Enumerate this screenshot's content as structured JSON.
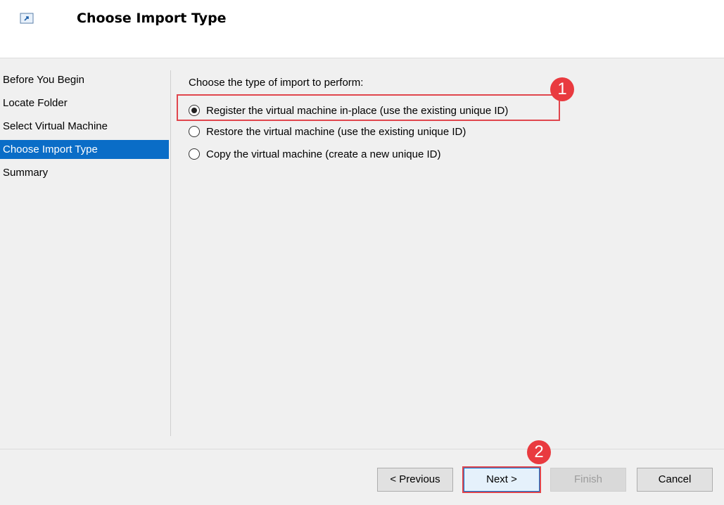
{
  "header": {
    "title": "Choose Import Type",
    "icon": "import-wizard-icon"
  },
  "nav": {
    "items": [
      {
        "label": "Before You Begin",
        "selected": false
      },
      {
        "label": "Locate Folder",
        "selected": false
      },
      {
        "label": "Select Virtual Machine",
        "selected": false
      },
      {
        "label": "Choose Import Type",
        "selected": true
      },
      {
        "label": "Summary",
        "selected": false
      }
    ]
  },
  "content": {
    "prompt": "Choose the type of import to perform:",
    "options": [
      {
        "label": "Register the virtual machine in-place (use the existing unique ID)",
        "checked": true
      },
      {
        "label": "Restore the virtual machine (use the existing unique ID)",
        "checked": false
      },
      {
        "label": "Copy the virtual machine (create a new unique ID)",
        "checked": false
      }
    ]
  },
  "annotations": {
    "step1": "1",
    "step2": "2",
    "highlight_color": "#e0464d",
    "badge_color": "#e93a3f"
  },
  "buttons": {
    "previous": "< Previous",
    "next": "Next >",
    "finish": "Finish",
    "cancel": "Cancel"
  },
  "colors": {
    "selection": "#0a6dc7",
    "background": "#f0f0f0"
  }
}
